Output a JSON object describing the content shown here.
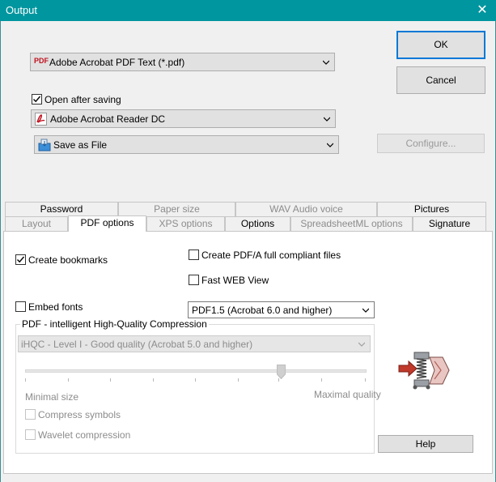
{
  "window": {
    "title": "Output",
    "close_glyph": "✕"
  },
  "format_combo": {
    "icon_text": "PDF",
    "value": "Adobe Acrobat PDF Text (*.pdf)"
  },
  "open_after_saving": {
    "label": "Open after saving",
    "checked": true
  },
  "viewer_combo": {
    "value": "Adobe Acrobat Reader DC"
  },
  "save_combo": {
    "value": "Save as File"
  },
  "buttons": {
    "ok": "OK",
    "cancel": "Cancel",
    "configure": "Configure...",
    "help": "Help"
  },
  "tabs_row1": [
    "Password",
    "Paper size",
    "WAV Audio voice",
    "Pictures"
  ],
  "tabs_row2": [
    "Layout",
    "PDF options",
    "XPS options",
    "Options",
    "SpreadsheetML options",
    "Signature"
  ],
  "pdf_options": {
    "create_bookmarks": "Create bookmarks",
    "create_pdfa": "Create PDF/A full compliant files",
    "fast_web_view": "Fast WEB View",
    "embed_fonts": "Embed fonts",
    "pdf_version": "PDF1.5 (Acrobat 6.0 and higher)",
    "compression_group": "PDF - intelligent High-Quality Compression",
    "compression_level": "iHQC - Level I - Good quality (Acrobat 5.0 and higher)",
    "slider_min_label": "Minimal size",
    "slider_max_label": "Maximal quality",
    "slider_position": 0.75,
    "compress_symbols": "Compress symbols",
    "wavelet_compression": "Wavelet compression"
  },
  "colors": {
    "title_bar": "#00969f",
    "default_button_border": "#0078d7",
    "pdf_icon_red": "#c1121f"
  }
}
